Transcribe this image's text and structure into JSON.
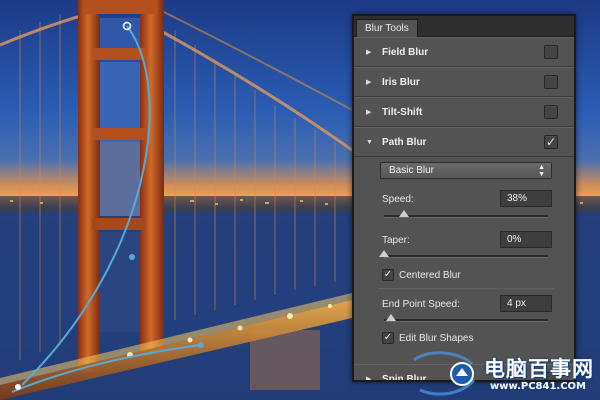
{
  "panel": {
    "tab_label": "Blur Tools",
    "sections": [
      {
        "label": "Field Blur",
        "expanded": false,
        "checked": false
      },
      {
        "label": "Iris Blur",
        "expanded": false,
        "checked": false
      },
      {
        "label": "Tilt-Shift",
        "expanded": false,
        "checked": false
      },
      {
        "label": "Path Blur",
        "expanded": true,
        "checked": true
      },
      {
        "label": "Spin Blur",
        "expanded": false,
        "checked": false
      }
    ],
    "path_blur": {
      "mode": "Basic Blur",
      "speed_label": "Speed:",
      "speed_value": "38%",
      "speed_level": 0.12,
      "taper_label": "Taper:",
      "taper_value": "0%",
      "taper_level": 0,
      "centered_blur_label": "Centered Blur",
      "centered_blur_checked": true,
      "end_point_speed_label": "End Point Speed:",
      "end_point_speed_value": "4 px",
      "end_point_level": 0.04,
      "edit_blur_shapes_label": "Edit Blur Shapes",
      "edit_blur_shapes_checked": true
    }
  },
  "watermark": {
    "text": "电脑百事网",
    "url": "www.PC841.COM"
  },
  "icons": {
    "collapsed": "triangle-right-icon",
    "expanded": "triangle-down-icon",
    "check": "checkmark-icon",
    "dropdown": "up-down-arrows-icon"
  },
  "colors": {
    "panel_bg": "#535353",
    "path_line": "#5aa8d6",
    "sky_top": "#1f3f8f",
    "sky_horizon": "#e8833a",
    "bridge": "#c0501e"
  }
}
